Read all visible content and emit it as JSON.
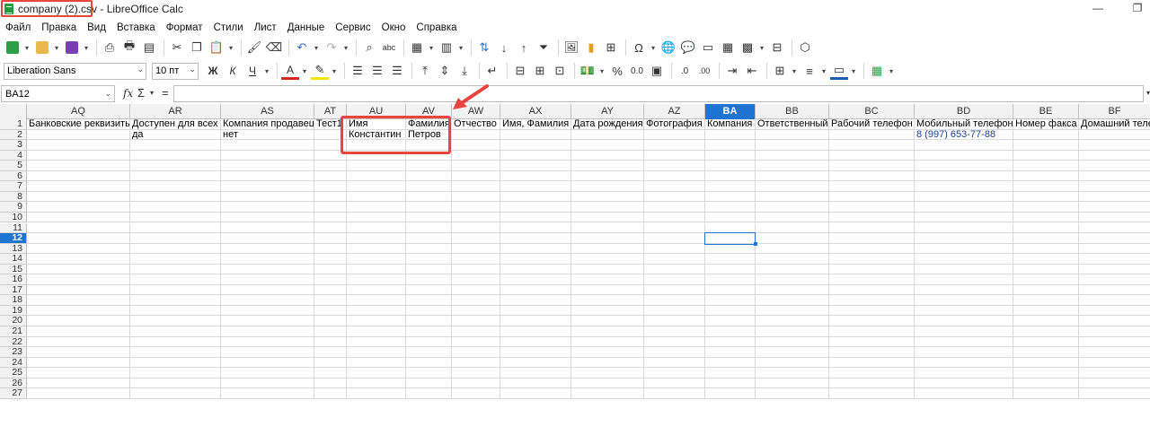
{
  "window": {
    "title": "company (2).csv - LibreOffice Calc",
    "minimize": "—",
    "restore": "❐"
  },
  "menu": [
    "Файл",
    "Правка",
    "Вид",
    "Вставка",
    "Формат",
    "Стили",
    "Лист",
    "Данные",
    "Сервис",
    "Окно",
    "Справка"
  ],
  "toolbar2": {
    "font_name": "Liberation Sans",
    "font_size": "10 пт",
    "bold": "Ж",
    "italic": "К",
    "underline": "Ч",
    "percent": "%",
    "decimal": "0.0",
    "add_decimal": ".0",
    "remove_decimal": ".00"
  },
  "formula": {
    "name_box": "BA12",
    "fx": "fx",
    "sigma": "Σ",
    "equals": "=",
    "content": ""
  },
  "columns": [
    {
      "id": "AQ",
      "w": 115
    },
    {
      "id": "AR",
      "w": 101
    },
    {
      "id": "AS",
      "w": 104
    },
    {
      "id": "AT",
      "w": 36
    },
    {
      "id": "AU",
      "w": 66
    },
    {
      "id": "AV",
      "w": 51
    },
    {
      "id": "AW",
      "w": 54
    },
    {
      "id": "AX",
      "w": 79
    },
    {
      "id": "AY",
      "w": 81
    },
    {
      "id": "AZ",
      "w": 68
    },
    {
      "id": "BA",
      "w": 56
    },
    {
      "id": "BB",
      "w": 82
    },
    {
      "id": "BC",
      "w": 95
    },
    {
      "id": "BD",
      "w": 110
    },
    {
      "id": "BE",
      "w": 73
    },
    {
      "id": "BF",
      "w": 80
    }
  ],
  "selected": {
    "col": "BA",
    "row": 12
  },
  "rows": [
    [
      "Банковские реквизиты",
      "Доступен для всех",
      "Компания продавец",
      "Тест1",
      "Имя",
      "Фамилия",
      "Отчество",
      "Имя, Фамилия",
      "Дата рождения",
      "Фотография",
      "Компания",
      "Ответственный",
      "Рабочий телефон",
      "Мобильный телефон",
      "Номер факса",
      "Домашний телефон"
    ],
    [
      "",
      "да",
      "нет",
      "",
      "Константин",
      "Петров",
      "",
      "",
      "",
      "",
      "",
      "",
      "",
      "8 (997) 653-77-88",
      "",
      ""
    ]
  ],
  "row_count": 27,
  "colors": {
    "accent": "#1e74d0",
    "annotation": "#e8453c",
    "phone": "#1b3f8f"
  }
}
